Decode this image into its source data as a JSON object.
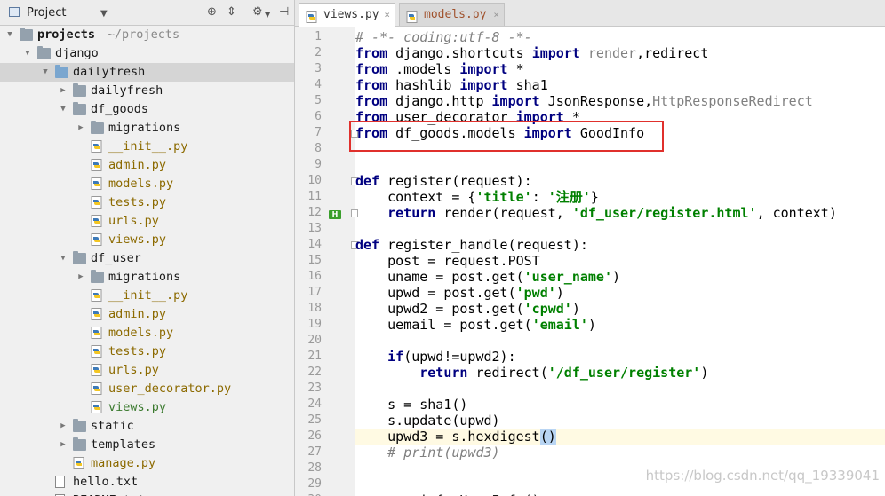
{
  "project_panel": {
    "title": "Project",
    "dropdown_icon": "chevron-down-icon",
    "tree": [
      {
        "label": "projects",
        "suffix": "~/projects",
        "type": "folder",
        "level": 0,
        "arrow": "down",
        "bold": true
      },
      {
        "label": "django",
        "type": "folder",
        "level": 1,
        "arrow": "down"
      },
      {
        "label": "dailyfresh",
        "type": "folder-blue",
        "level": 2,
        "arrow": "down",
        "selected": true
      },
      {
        "label": "dailyfresh",
        "type": "folder",
        "level": 3,
        "arrow": "right"
      },
      {
        "label": "df_goods",
        "type": "folder",
        "level": 3,
        "arrow": "down"
      },
      {
        "label": "migrations",
        "type": "folder",
        "level": 4,
        "arrow": "right"
      },
      {
        "label": "__init__.py",
        "type": "py",
        "level": 4
      },
      {
        "label": "admin.py",
        "type": "py",
        "level": 4
      },
      {
        "label": "models.py",
        "type": "py",
        "level": 4
      },
      {
        "label": "tests.py",
        "type": "py",
        "level": 4
      },
      {
        "label": "urls.py",
        "type": "py",
        "level": 4
      },
      {
        "label": "views.py",
        "type": "py",
        "level": 4
      },
      {
        "label": "df_user",
        "type": "folder",
        "level": 3,
        "arrow": "down"
      },
      {
        "label": "migrations",
        "type": "folder",
        "level": 4,
        "arrow": "right"
      },
      {
        "label": "__init__.py",
        "type": "py",
        "level": 4
      },
      {
        "label": "admin.py",
        "type": "py",
        "level": 4
      },
      {
        "label": "models.py",
        "type": "py",
        "level": 4
      },
      {
        "label": "tests.py",
        "type": "py",
        "level": 4
      },
      {
        "label": "urls.py",
        "type": "py",
        "level": 4
      },
      {
        "label": "user_decorator.py",
        "type": "py",
        "level": 4
      },
      {
        "label": "views.py",
        "type": "py-green",
        "level": 4
      },
      {
        "label": "static",
        "type": "folder",
        "level": 3,
        "arrow": "right"
      },
      {
        "label": "templates",
        "type": "folder",
        "level": 3,
        "arrow": "right"
      },
      {
        "label": "manage.py",
        "type": "py",
        "level": 3
      },
      {
        "label": "hello.txt",
        "type": "txt",
        "level": 2
      },
      {
        "label": "README.txt",
        "type": "txt",
        "level": 2
      }
    ]
  },
  "tabs": [
    {
      "label": "views.py",
      "active": true,
      "close": "×"
    },
    {
      "label": "models.py",
      "active": false,
      "close": "×"
    }
  ],
  "editor": {
    "current_line": 26,
    "lines": [
      [
        {
          "t": "# -*- coding:utf-8 -*-",
          "c": "cmt"
        }
      ],
      [
        {
          "t": "from",
          "c": "kw"
        },
        {
          "t": " django.shortcuts "
        },
        {
          "t": "import",
          "c": "kw"
        },
        {
          "t": " render",
          "c": "dim"
        },
        {
          "t": ",redirect"
        }
      ],
      [
        {
          "t": "from",
          "c": "kw"
        },
        {
          "t": " .models "
        },
        {
          "t": "import",
          "c": "kw"
        },
        {
          "t": " *"
        }
      ],
      [
        {
          "t": "from",
          "c": "kw"
        },
        {
          "t": " hashlib "
        },
        {
          "t": "import",
          "c": "kw"
        },
        {
          "t": " sha1"
        }
      ],
      [
        {
          "t": "from",
          "c": "kw"
        },
        {
          "t": " django.http "
        },
        {
          "t": "import",
          "c": "kw"
        },
        {
          "t": " JsonResponse,"
        },
        {
          "t": "HttpResponseRedirect",
          "c": "dim"
        }
      ],
      [
        {
          "t": "from",
          "c": "kw"
        },
        {
          "t": " user_decorator "
        },
        {
          "t": "import",
          "c": "kw"
        },
        {
          "t": " *"
        }
      ],
      [
        {
          "t": "from",
          "c": "kw"
        },
        {
          "t": " df_goods.models "
        },
        {
          "t": "import",
          "c": "kw"
        },
        {
          "t": " GoodInfo"
        }
      ],
      [],
      [],
      [
        {
          "t": "def",
          "c": "kw"
        },
        {
          "t": " register(request):"
        }
      ],
      [
        {
          "t": "    context = {"
        },
        {
          "t": "'title'",
          "c": "str"
        },
        {
          "t": ": "
        },
        {
          "t": "'注册'",
          "c": "str"
        },
        {
          "t": "}"
        }
      ],
      [
        {
          "t": "    "
        },
        {
          "t": "return",
          "c": "kw"
        },
        {
          "t": " render(request, "
        },
        {
          "t": "'df_user/register.html'",
          "c": "str"
        },
        {
          "t": ", context)"
        }
      ],
      [],
      [
        {
          "t": "def",
          "c": "kw"
        },
        {
          "t": " register_handle(request):"
        }
      ],
      [
        {
          "t": "    post = request.POST"
        }
      ],
      [
        {
          "t": "    uname = post.get("
        },
        {
          "t": "'user_name'",
          "c": "str"
        },
        {
          "t": ")"
        }
      ],
      [
        {
          "t": "    upwd = post.get("
        },
        {
          "t": "'pwd'",
          "c": "str"
        },
        {
          "t": ")"
        }
      ],
      [
        {
          "t": "    upwd2 = post.get("
        },
        {
          "t": "'cpwd'",
          "c": "str"
        },
        {
          "t": ")"
        }
      ],
      [
        {
          "t": "    uemail = post.get("
        },
        {
          "t": "'email'",
          "c": "str"
        },
        {
          "t": ")"
        }
      ],
      [],
      [
        {
          "t": "    "
        },
        {
          "t": "if",
          "c": "kw"
        },
        {
          "t": "(upwd!=upwd2):"
        }
      ],
      [
        {
          "t": "        "
        },
        {
          "t": "return",
          "c": "kw"
        },
        {
          "t": " redirect("
        },
        {
          "t": "'/df_user/register'",
          "c": "str"
        },
        {
          "t": ")"
        }
      ],
      [],
      [
        {
          "t": "    s = sha1()"
        }
      ],
      [
        {
          "t": "    s.update(upwd)"
        }
      ],
      [
        {
          "t": "    upwd3 = s.hexdigest"
        },
        {
          "t": "()",
          "c": "bm"
        }
      ],
      [
        {
          "t": "    "
        },
        {
          "t": "# print(upwd3)",
          "c": "cmt"
        }
      ],
      [],
      [],
      [
        {
          "t": "        info=UserInfo()",
          "c": "plain"
        }
      ]
    ]
  },
  "watermark": "https://blog.csdn.net/qq_19339041",
  "colors": {
    "highlight_box": "#e0302c",
    "keyword": "#000080",
    "string": "#008000"
  }
}
